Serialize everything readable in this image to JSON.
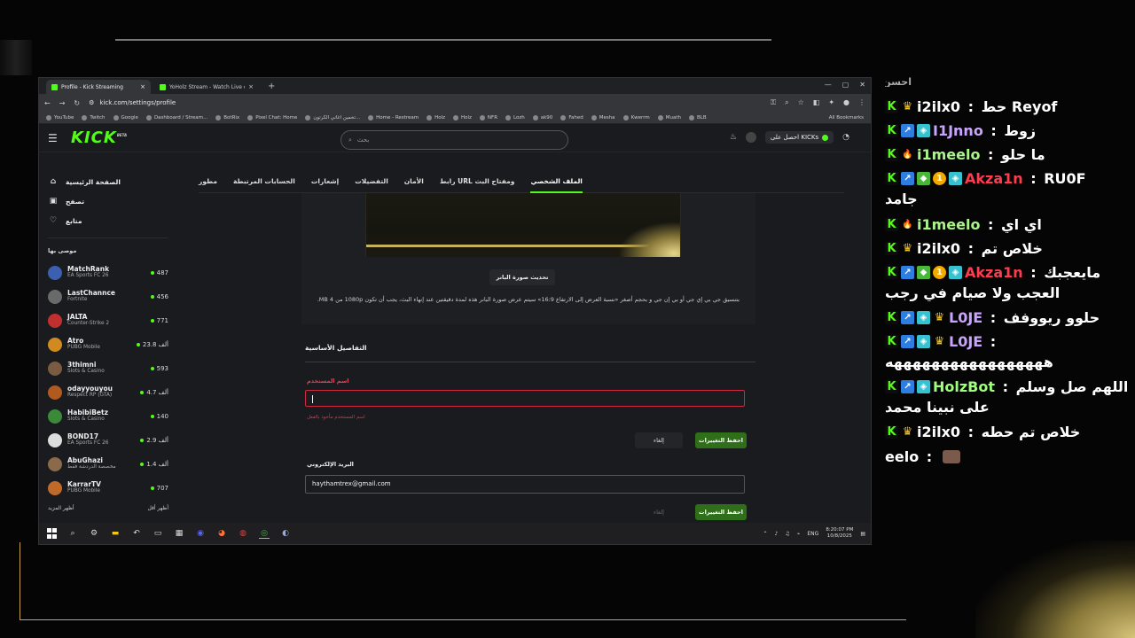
{
  "browser": {
    "tabs": [
      {
        "title": "Profile - Kick Streaming",
        "active": true
      },
      {
        "title": "YoHolz Stream - Watch Live on",
        "active": false
      }
    ],
    "url": "kick.com/settings/profile",
    "bookmarks": [
      "YouTube",
      "Twitch",
      "Google",
      "Dashboard / Stream...",
      "BotRix",
      "Pixel Chat: Home",
      "تخمين اغاني الكرتون...",
      "Home - Restream",
      "Holz",
      "Holz",
      "NFR",
      "Lozh",
      "ak90",
      "Fahed",
      "Mesha",
      "Kwerrm",
      "Muath",
      "BLB"
    ],
    "all_bookmarks": "All Bookmarks"
  },
  "kick": {
    "logo": "KICK",
    "logo_tag": "BETA",
    "search_placeholder": "بحث",
    "get_kicks": "احصل على KICKs",
    "nav": [
      {
        "label": "الصفحة الرئيسية",
        "icon": "home-icon",
        "glyph": "⌂"
      },
      {
        "label": "تصفح",
        "icon": "browse-icon",
        "glyph": "▣"
      },
      {
        "label": "متابع",
        "icon": "heart-icon",
        "glyph": "♡"
      }
    ],
    "recommended_title": "موصى بها",
    "channels": [
      {
        "name": "MatchRank",
        "game": "EA Sports FC 26",
        "viewers": "487",
        "color": "#3d5fb0"
      },
      {
        "name": "LastChannce",
        "game": "Fortnite",
        "viewers": "456",
        "color": "#6a6a6a"
      },
      {
        "name": "JALTA",
        "game": "Counter-Strike 2",
        "viewers": "771",
        "color": "#c03030"
      },
      {
        "name": "Atro",
        "game": "PUBG Mobile",
        "viewers": "23.8 ألف",
        "color": "#d08a20"
      },
      {
        "name": "3thimni",
        "game": "Slots & Casino",
        "viewers": "593",
        "color": "#7a5a40"
      },
      {
        "name": "odayyouyou",
        "game": "Respect RP (GTA)",
        "viewers": "4.7 ألف",
        "color": "#b05a20"
      },
      {
        "name": "HabibiBetz",
        "game": "Slots & Casino",
        "viewers": "140",
        "color": "#3a8a3a"
      },
      {
        "name": "BOND17",
        "game": "EA Sports FC 26",
        "viewers": "2.9 ألف",
        "color": "#dddddd"
      },
      {
        "name": "AbuGhazi",
        "game": "مخصصة الدردشة فقط",
        "viewers": "1.4 ألف",
        "color": "#8a6a4a"
      },
      {
        "name": "KarrarTV",
        "game": "PUBG Mobile",
        "viewers": "707",
        "color": "#c06a2a"
      }
    ],
    "show_more": "أظهر المزيد",
    "show_less": "أظهر أقل",
    "settings_tabs": [
      "الملف الشخصي",
      "رابط URL ومفتاح البث",
      "الأمان",
      "التفضيلات",
      "إشعارات",
      "الحسابات المرتبطة",
      "مطور"
    ],
    "banner_button": "تحديث صورة البانر",
    "banner_hint": "بتنسيق جي بي إي جي أو بي إن جي و بحجم أصغر «نسبة العرض إلى الارتفاع 16:9» سيتم عرض صورة البانر هذه لمدة دقيقتين عند إنهاء البث، يجب أن تكون 1080p من 4 MB.",
    "section_title": "التفاصيل الأساسية",
    "username_label": "اسم المستخدم",
    "username_value": "",
    "username_error": "اسم المستخدم مأخوذ بالفعل",
    "cancel": "إلغاء",
    "save": "احفظ التغييرات",
    "email_label": "البريد الإلكتروني",
    "email_value": "haythamtrex@gmail.com"
  },
  "taskbar": {
    "lang": "ENG",
    "time": "8:20:07 PM",
    "date": "10/8/2025"
  },
  "chat": {
    "top_fragment": "احسن",
    "messages": [
      {
        "badges": [
          "kick",
          "crown"
        ],
        "user": "i2ilx0",
        "user_color": "u",
        "text": "حط Reyof"
      },
      {
        "badges": [
          "kick",
          "blue",
          "cyan"
        ],
        "user": "I1Jnno",
        "user_color": "u-purple",
        "text": "زوط"
      },
      {
        "badges": [
          "kick",
          "fire"
        ],
        "user": "i1meelo",
        "user_color": "u-lime",
        "text": "ما حلو"
      },
      {
        "badges": [
          "kick",
          "blue",
          "green",
          "gold",
          "cyan"
        ],
        "user": "Akza1n",
        "user_color": "u-red",
        "text": "RU0F"
      },
      {
        "badges": [
          "kick",
          "fire"
        ],
        "user": "i1meelo",
        "user_color": "u-lime",
        "text": "اي اي"
      },
      {
        "badges": [
          "kick",
          "crown"
        ],
        "user": "i2ilx0",
        "user_color": "u",
        "text": "خلاص تم"
      },
      {
        "badges": [
          "kick",
          "blue",
          "green",
          "gold",
          "cyan"
        ],
        "user": "Akza1n",
        "user_color": "u-red",
        "text": "مايعجبك"
      },
      {
        "badges": [
          "kick",
          "blue",
          "cyan",
          "crown"
        ],
        "user": "L0JE",
        "user_color": "u-purple",
        "text": "حلوو ريووفف"
      },
      {
        "badges": [
          "kick",
          "blue",
          "cyan",
          "crown"
        ],
        "user": "L0JE",
        "user_color": "u-purple",
        "text": ""
      },
      {
        "badges": [
          "kick",
          "blue",
          "cyan"
        ],
        "user": "HolzBot",
        "user_color": "u-green",
        "text": "اللهم صل وسلم"
      },
      {
        "badges": [
          "kick",
          "crown"
        ],
        "user": "i2ilx0",
        "user_color": "u",
        "text": "خلاص تم حطه"
      },
      {
        "badges": [],
        "user": "eelo",
        "user_color": "u",
        "text": ""
      }
    ],
    "wraps": [
      "جامد",
      "العجب ولا صيام في رجب",
      "هههههههههههههههههه",
      "على نبينا محمد"
    ]
  }
}
